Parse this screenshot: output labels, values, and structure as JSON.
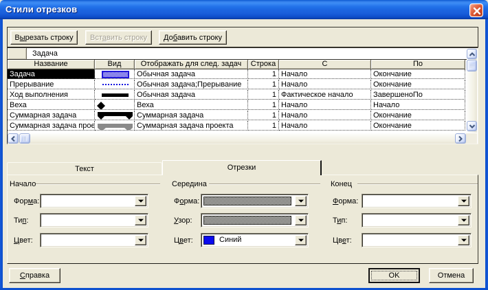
{
  "window": {
    "title": "Стили отрезков"
  },
  "toolbar": {
    "cut": {
      "text": "Вырезать строку",
      "u": 1
    },
    "paste": {
      "text": "Вставить строку",
      "u": 3
    },
    "insert": {
      "text": "Добавить строку",
      "u": 2
    }
  },
  "entry": {
    "value": "Задача"
  },
  "table": {
    "columns": [
      "Название",
      "Вид",
      "Отображать для след. задач",
      "Строка",
      "С",
      "По"
    ],
    "rows": [
      {
        "name": "Задача",
        "shape": "task-bar",
        "show_for": "Обычная задача",
        "row": "1",
        "from": "Начало",
        "to": "Окончание"
      },
      {
        "name": "Прерывание",
        "shape": "split-dotted-bar",
        "show_for": "Обычная задача;Прерывание",
        "row": "1",
        "from": "Начало",
        "to": "Окончание"
      },
      {
        "name": "Ход выполнения",
        "shape": "progress-bar",
        "show_for": "Обычная задача",
        "row": "1",
        "from": "Фактическое начало",
        "to": "ЗавершеноПо"
      },
      {
        "name": "Веха",
        "shape": "milestone-diamond",
        "show_for": "Веха",
        "row": "1",
        "from": "Начало",
        "to": "Начало"
      },
      {
        "name": "Суммарная задача",
        "shape": "summary-bar",
        "show_for": "Суммарная задача",
        "row": "1",
        "from": "Начало",
        "to": "Окончание"
      },
      {
        "name": "Суммарная задача проекта",
        "shape": "project-summary-bar",
        "show_for": "Суммарная задача проекта",
        "row": "1",
        "from": "Начало",
        "to": "Окончание"
      }
    ]
  },
  "tabs": {
    "text": "Текст",
    "bars": "Отрезки"
  },
  "groups": {
    "start": {
      "title": "Начало",
      "shape": {
        "label": {
          "text": "Форма:",
          "u": 3
        },
        "value": ""
      },
      "type": {
        "label": {
          "text": "Тип:",
          "u": 2
        },
        "value": ""
      },
      "color": {
        "label": {
          "text": "Цвет:",
          "u": 0
        },
        "value": ""
      }
    },
    "middle": {
      "title": "Середина",
      "shape": {
        "label": {
          "text": "Форма:",
          "u": 1
        },
        "value": "checkered-pattern"
      },
      "pattern": {
        "label": {
          "text": "Узор:",
          "u": 0
        },
        "value": "checkered-pattern"
      },
      "color": {
        "label": {
          "text": "Цвет:",
          "u": 1
        },
        "value": "Синий",
        "swatch": "#0b0bee"
      }
    },
    "end": {
      "title": "Конец",
      "shape": {
        "label": {
          "text": "Форма:",
          "u": 0
        },
        "value": ""
      },
      "type": {
        "label": {
          "text": "Тип:",
          "u": 1
        },
        "value": ""
      },
      "color": {
        "label": {
          "text": "Цвет:",
          "u": 2
        },
        "value": ""
      }
    }
  },
  "buttons": {
    "help": {
      "text": "Справка",
      "u": 0
    },
    "ok": "OK",
    "cancel": "Отмена"
  },
  "colors": {
    "dialog_face": "#ece9d8",
    "title_gradient_top": "#3f8cf4",
    "title_gradient_bottom": "#0a41b2",
    "close_button_red": "#d8502b",
    "selected_row_bg": "#000000",
    "task_bar_blue": "#2016d8",
    "color_swatch_blue": "#0b0bee",
    "summary_bar_black": "#000000",
    "project_summary_gray": "#8a8a8a"
  }
}
